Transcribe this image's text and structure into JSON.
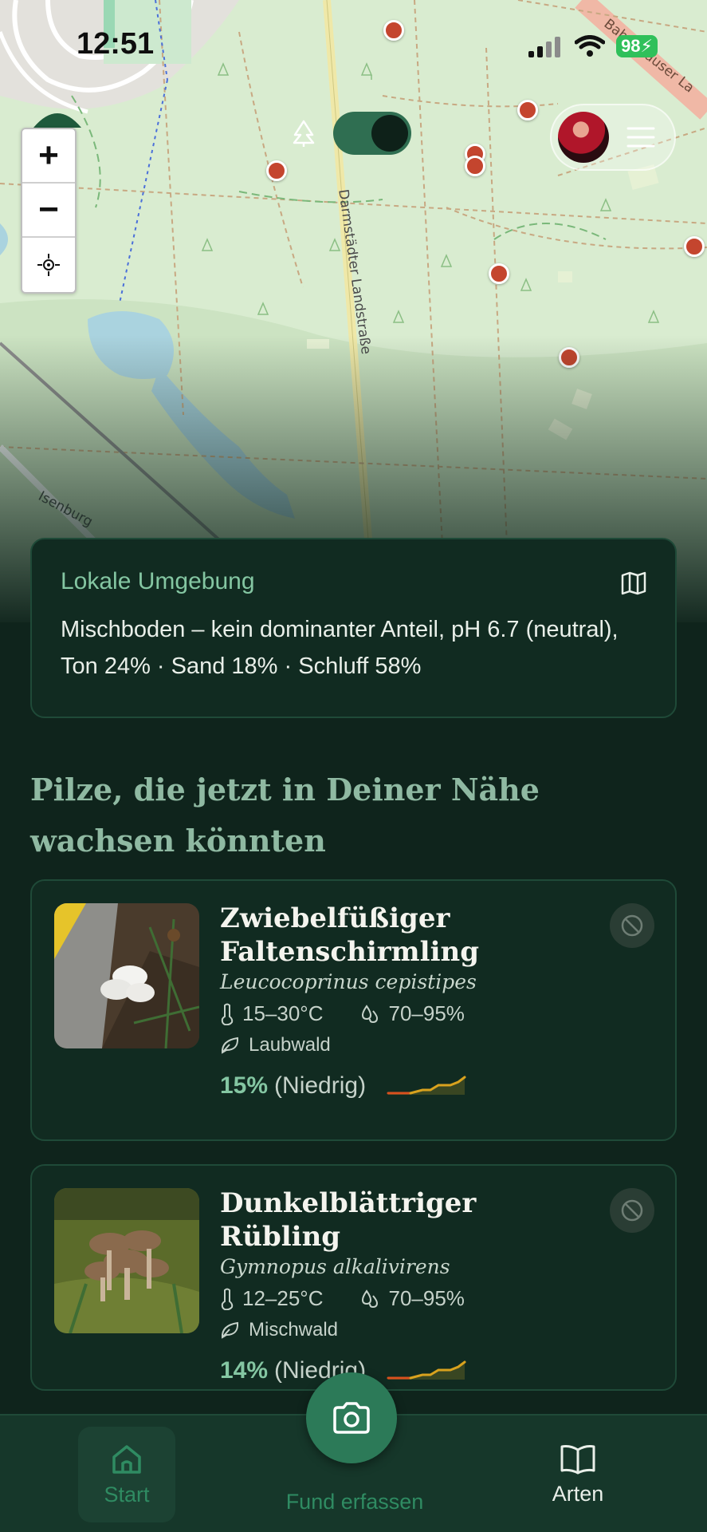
{
  "status_bar": {
    "time": "12:51",
    "battery": "98"
  },
  "map": {
    "road_labels": [
      "Darmstädter Landstraße",
      "Isenburg",
      "Babenhauser La"
    ],
    "toggle_on": true
  },
  "environment": {
    "title": "Lokale Umgebung",
    "text": "Mischboden – kein dominanter Anteil, pH 6.7 (neutral), Ton 24% · Sand 18% · Schluff 58%"
  },
  "section": {
    "heading": "Pilze, die jetzt in Deiner Nähe wachsen könnten"
  },
  "mushrooms": [
    {
      "name": "Zwiebelfüßiger Faltenschirmling",
      "latin": "Leucocoprinus cepistipes",
      "temperature": "15–30°C",
      "humidity": "70–95%",
      "habitat": "Laubwald",
      "probability": "15%",
      "probability_label": "(Niedrig)"
    },
    {
      "name": "Dunkelblättriger Rübling",
      "latin": "Gymnopus alkalivirens",
      "temperature": "12–25°C",
      "humidity": "70–95%",
      "habitat": "Mischwald",
      "probability": "14%",
      "probability_label": "(Niedrig)"
    }
  ],
  "nav": {
    "start": "Start",
    "fund": "Fund erfassen",
    "arten": "Arten"
  },
  "colors": {
    "accent": "#84c6a2",
    "background": "#0f241c",
    "marker": "#c4452e"
  }
}
